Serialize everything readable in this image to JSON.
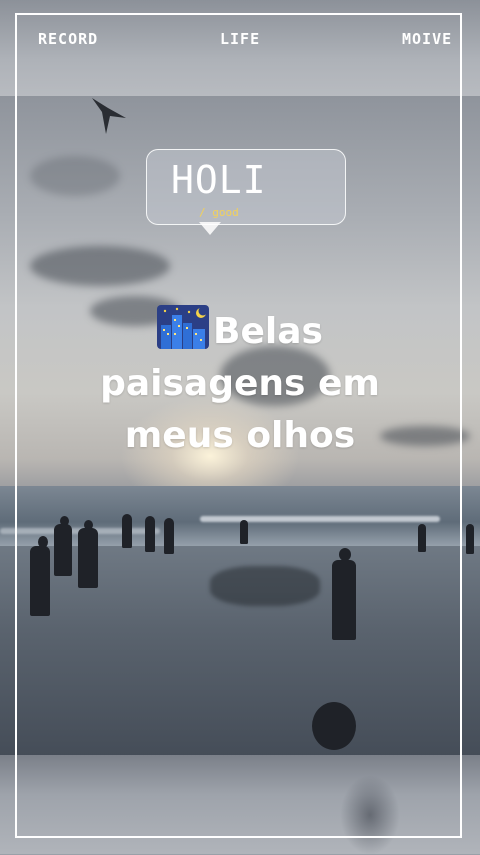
{
  "top_nav": {
    "left": "RECORD",
    "center": "LIFE",
    "right": "MOIVE"
  },
  "bubble": {
    "title": "HOLI",
    "subtitle": "/ good"
  },
  "caption": {
    "icon": "city-night-icon",
    "line1": "Belas",
    "line2": "paisagens em",
    "line3": "meus olhos"
  },
  "colors": {
    "frame": "#ffffff",
    "subtitle_accent": "#f2d15b"
  }
}
